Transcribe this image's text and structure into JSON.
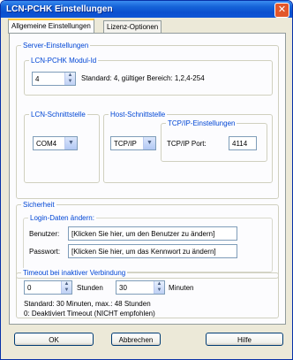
{
  "window": {
    "title": "LCN-PCHK Einstellungen",
    "close_glyph": "✕"
  },
  "tabs": [
    {
      "label": "Allgemeine Einstellungen",
      "active": true
    },
    {
      "label": "Lizenz-Optionen",
      "active": false
    }
  ],
  "server": {
    "legend": "Server-Einstellungen",
    "modul": {
      "legend": "LCN-PCHK Modul-Id",
      "value": "4",
      "hint": "Standard: 4, gültiger Bereich: 1,2,4-254"
    },
    "lcn": {
      "legend": "LCN-Schnittstelle",
      "value": "COM4"
    },
    "host": {
      "legend": "Host-Schnittstelle",
      "value": "TCP/IP",
      "tcpip": {
        "legend": "TCP/IP-Einstellungen",
        "port_label": "TCP/IP Port:",
        "port_value": "4114"
      }
    }
  },
  "security": {
    "legend": "Sicherheit",
    "login": {
      "legend": "Login-Daten ändern:",
      "user_label": "Benutzer:",
      "user_value": "[Klicken Sie hier, um den Benutzer zu ändern]",
      "password_label": "Passwort:",
      "password_value": "[Klicken Sie hier, um das Kennwort zu ändern]"
    }
  },
  "timeout": {
    "legend": "Timeout bei inaktiver Verbindung",
    "hours_value": "0",
    "hours_label": "Stunden",
    "minutes_value": "30",
    "minutes_label": "Minuten",
    "info1": "Standard: 30 Minuten, max.: 48 Stunden",
    "info2": "0: Deaktiviert Timeout (NICHT empfohlen)"
  },
  "buttons": {
    "ok": "OK",
    "cancel": "Abbrechen",
    "help": "Hilfe"
  }
}
